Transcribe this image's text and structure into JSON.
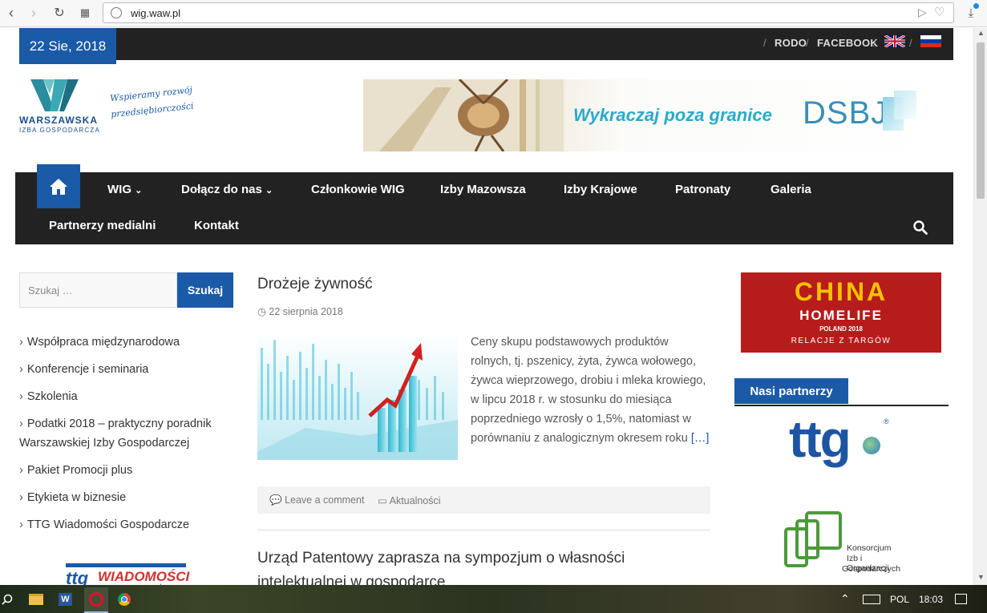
{
  "browser": {
    "url": "wig.waw.pl"
  },
  "topbar": {
    "date": "22 Sie, 2018",
    "links": [
      "RODO",
      "FACEBOOK"
    ]
  },
  "header": {
    "logo_line1": "WARSZAWSKA",
    "logo_line2": "IZBA GOSPODARCZA",
    "logo_tagline1": "Wspieramy rozwój",
    "logo_tagline2": "przedsiębiorczości",
    "banner_text": "Wykraczaj poza granice",
    "banner_brand": "DSBJ"
  },
  "nav": {
    "items": [
      "WIG",
      "Dołącz do nas",
      "Członkowie WIG",
      "Izby Mazowsza",
      "Izby Krajowe",
      "Patronaty",
      "Galeria",
      "Partnerzy medialni",
      "Kontakt"
    ]
  },
  "sidebar": {
    "search_placeholder": "Szukaj …",
    "search_button": "Szukaj",
    "categories": [
      "Współpraca międzynarodowa",
      "Konferencje i seminaria",
      "Szkolenia",
      "Podatki 2018 – praktyczny poradnik Warszawskiej Izby Gospodarczej",
      "Pakiet Promocji plus",
      "Etykieta w biznesie",
      "TTG Wiadomości Gospodarcze"
    ],
    "ttg_logo_text": "ttg",
    "ttg_logo_word": "WIADOMOŚCI",
    "ttg_logo_word2": "gospodarcze"
  },
  "main": {
    "post1": {
      "title": "Drożeje żywność",
      "date": "22 sierpnia 2018",
      "excerpt": "Ceny skupu podstawowych produktów rolnych, tj. pszenicy, żyta, żywca wołowego, żywca wieprzowego, drobiu i mleka krowiego, w lipcu 2018 r. w stosunku do miesiąca poprzedniego wzrosły o 1,5%, natomiast w porównaniu z analogicznym okresem roku",
      "more": "[…]",
      "comment": "Leave a comment",
      "category": "Aktualności"
    },
    "post2": {
      "title_line1": "Urząd Patentowy zaprasza na sympozjum o własności",
      "title_line2": "intelektualnej w gospodarce"
    }
  },
  "right": {
    "china_line1": "CHINA",
    "china_line2": "HOMELIFE",
    "china_line3": "POLAND 2018",
    "china_line4": "RELACJE Z TARGÓW",
    "partners_heading": "Nasi partnerzy",
    "ttg_text": "ttg",
    "konsorcjum_line1": "Konsorcjum",
    "konsorcjum_line2": "Izb i Organizacji",
    "konsorcjum_line3": "Gospodarczych"
  },
  "taskbar": {
    "lang": "POL",
    "time": "18:03"
  },
  "colors": {
    "accent": "#1a5aa6",
    "dark": "#222222"
  }
}
